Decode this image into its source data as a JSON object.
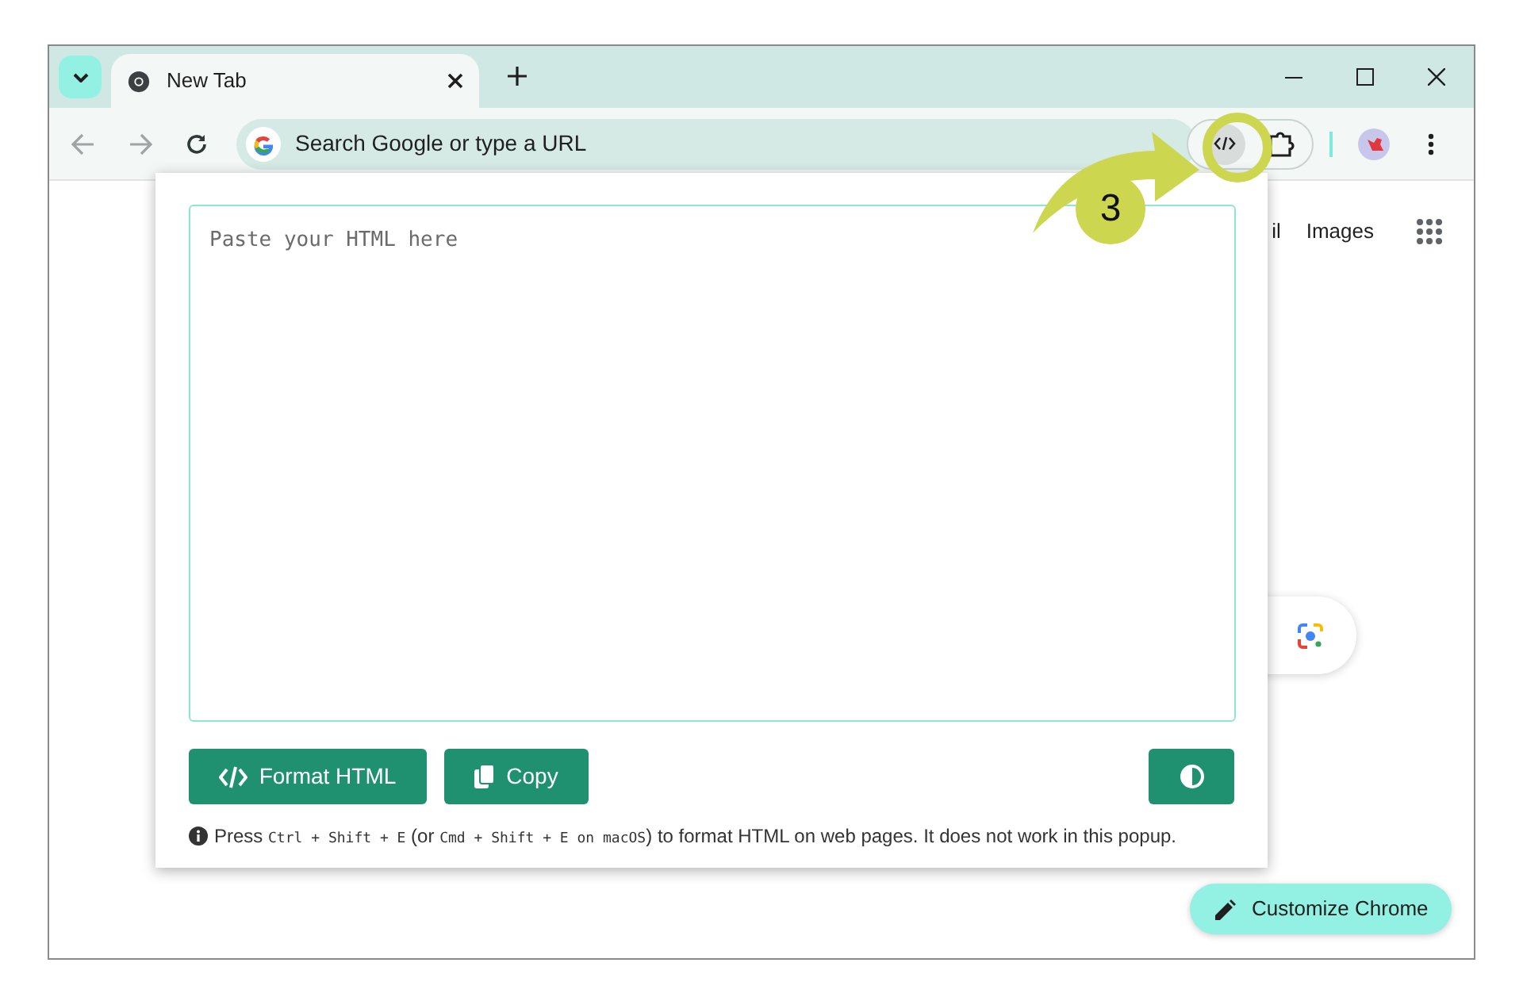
{
  "window": {
    "tab": {
      "title": "New Tab",
      "selected": true
    },
    "address_bar": {
      "placeholder": "Search Google or type a URL"
    }
  },
  "page": {
    "links": [
      "il",
      "Images"
    ],
    "customize_button": "Customize Chrome"
  },
  "popup": {
    "textarea": {
      "placeholder": "Paste your HTML here"
    },
    "buttons": [
      {
        "kind": "format",
        "label": "Format HTML"
      },
      {
        "kind": "copy",
        "label": "Copy"
      },
      {
        "kind": "theme"
      }
    ],
    "note": [
      {
        "kind": "text",
        "text": "Press "
      },
      {
        "kind": "key",
        "text": "Ctrl + Shift + E"
      },
      {
        "kind": "text",
        "text": " (or "
      },
      {
        "kind": "key",
        "text": "Cmd + Shift + E on macOS"
      },
      {
        "kind": "text",
        "text": ") to format HTML on web pages. It does not work in this popup."
      }
    ]
  },
  "annotation": {
    "step": "3"
  }
}
